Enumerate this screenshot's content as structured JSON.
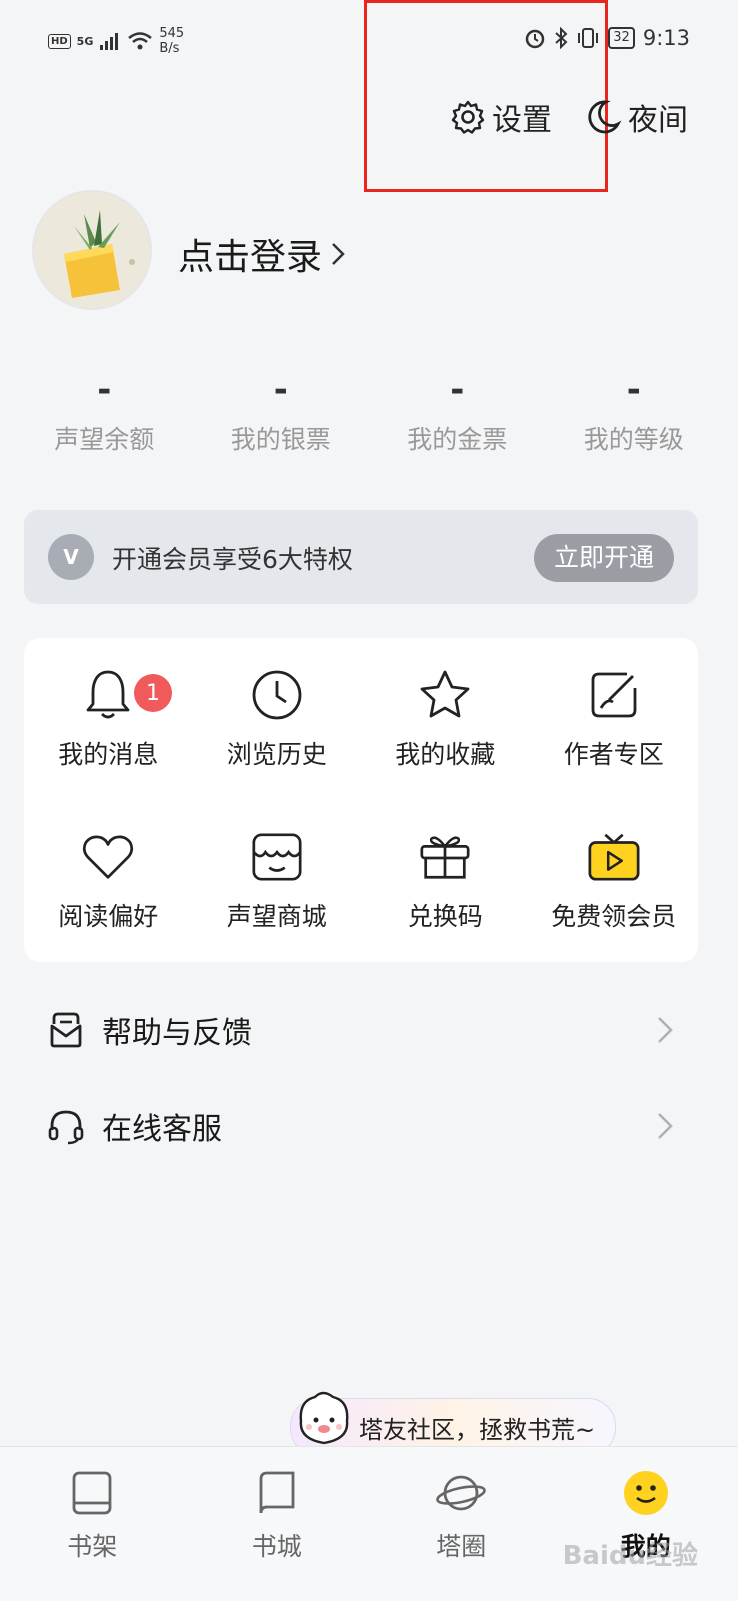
{
  "status_bar": {
    "hd": "HD",
    "network": "5G",
    "speed_value": "545",
    "speed_unit": "B/s",
    "battery": "32",
    "time": "9:13"
  },
  "header": {
    "settings_label": "设置",
    "night_label": "夜间"
  },
  "profile": {
    "login_label": "点击登录"
  },
  "stats": [
    {
      "value": "-",
      "label": "声望余额"
    },
    {
      "value": "-",
      "label": "我的银票"
    },
    {
      "value": "-",
      "label": "我的金票"
    },
    {
      "value": "-",
      "label": "我的等级"
    }
  ],
  "vip": {
    "icon_letter": "V",
    "text": "开通会员享受6大特权",
    "button": "立即开通"
  },
  "grid": {
    "messages": {
      "label": "我的消息",
      "badge": "1"
    },
    "history": {
      "label": "浏览历史"
    },
    "favorites": {
      "label": "我的收藏"
    },
    "author": {
      "label": "作者专区"
    },
    "preferences": {
      "label": "阅读偏好"
    },
    "store": {
      "label": "声望商城"
    },
    "redeem": {
      "label": "兑换码"
    },
    "free_vip": {
      "label": "免费领会员"
    }
  },
  "list": {
    "help": "帮助与反馈",
    "service": "在线客服"
  },
  "bubble": {
    "text": "塔友社区，拯救书荒~"
  },
  "tabs": [
    {
      "label": "书架"
    },
    {
      "label": "书城"
    },
    {
      "label": "塔圈"
    },
    {
      "label": "我的"
    }
  ],
  "watermark": "Baidu经验",
  "colors": {
    "background": "#f4f5f7",
    "badge": "#f05a5a",
    "highlight_box": "#e8261c",
    "vip_button": "#9a9ea4",
    "active_tab_icon": "#ffd21f"
  }
}
